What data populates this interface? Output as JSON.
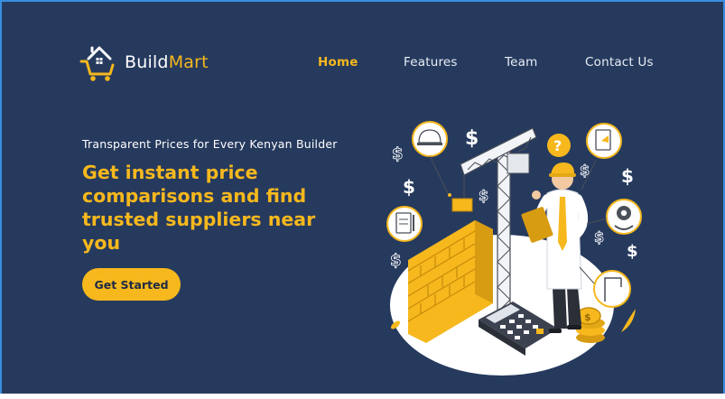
{
  "brand": {
    "name_part1": "Build",
    "name_part2": "Mart",
    "logo_icon": "house-cart-icon"
  },
  "nav": {
    "items": [
      {
        "label": "Home",
        "active": true
      },
      {
        "label": "Features",
        "active": false
      },
      {
        "label": "Team",
        "active": false
      },
      {
        "label": "Contact Us",
        "active": false
      }
    ]
  },
  "hero": {
    "tagline": "Transparent Prices for Every Kenyan Builder",
    "headline": "Get instant price comparisons and find trusted suppliers near you",
    "cta_label": "Get Started",
    "illustration": "construction-builder-illustration"
  },
  "colors": {
    "background": "#263a5e",
    "accent": "#f6b81d",
    "text": "#ffffff"
  }
}
